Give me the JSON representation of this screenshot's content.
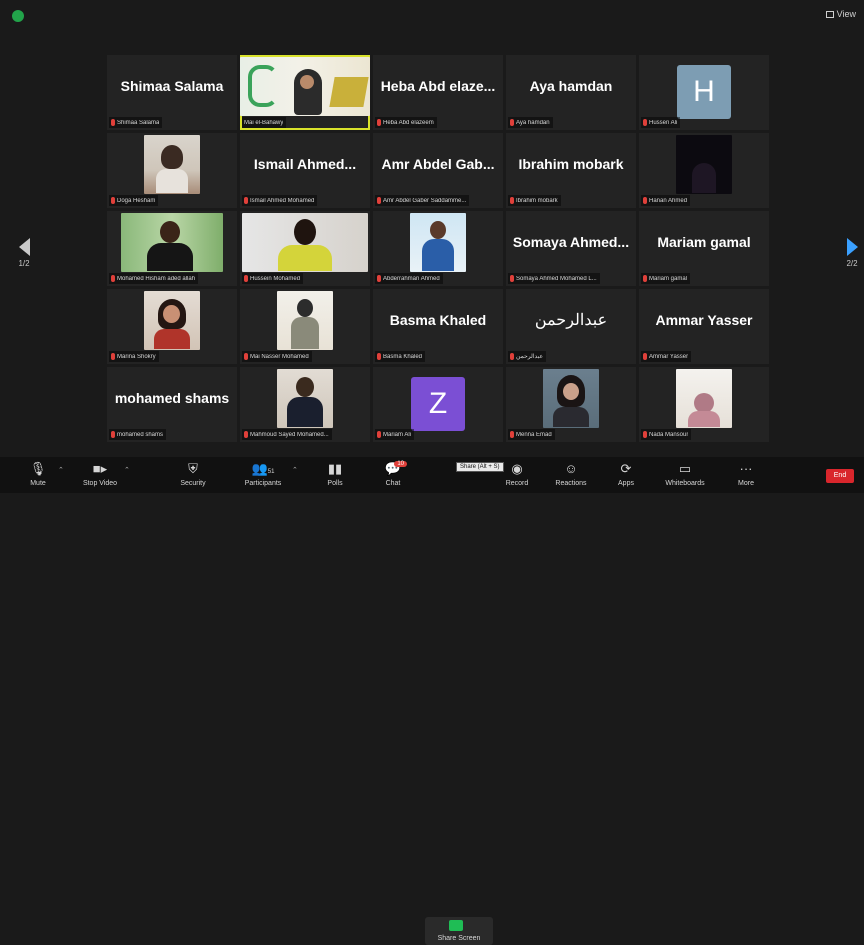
{
  "window": {
    "view_label": "View"
  },
  "tiles": [
    {
      "display_name": "Shimaa Salama",
      "label": "Shimaa Salama"
    },
    {
      "display_name": "",
      "label": "Mai el-Bahawy"
    },
    {
      "display_name": "Heba Abd elaze...",
      "label": "Heba Abd elazeem"
    },
    {
      "display_name": "Aya hamdan",
      "label": "Aya hamdan"
    },
    {
      "display_name": "",
      "label": "Hussen Ali",
      "avatar": "H",
      "avatar_color": "#7d9db3"
    },
    {
      "display_name": "",
      "label": "Doga Hesham"
    },
    {
      "display_name": "Ismail Ahmed...",
      "label": "Ismail Ahmed Mohamed"
    },
    {
      "display_name": "Amr Abdel Gab...",
      "label": "Amr Abdel Gaber Saddamme..."
    },
    {
      "display_name": "Ibrahim mobark",
      "label": "Ibrahim mobark"
    },
    {
      "display_name": "",
      "label": "Hanan Ahmed"
    },
    {
      "display_name": "",
      "label": "Mohamed Hisham aded allah"
    },
    {
      "display_name": "",
      "label": "Hussein Mohamed"
    },
    {
      "display_name": "",
      "label": "Abderrahman Ahmed"
    },
    {
      "display_name": "Somaya Ahmed...",
      "label": "Somaya Ahmed Mohamed L..."
    },
    {
      "display_name": "Mariam gamal",
      "label": "Mariam gamal"
    },
    {
      "display_name": "",
      "label": "Marina Shokry"
    },
    {
      "display_name": "",
      "label": "Mai Nasser Mohamed"
    },
    {
      "display_name": "Basma Khaled",
      "label": "Basma Khaled"
    },
    {
      "display_name": "عبدالرحمن",
      "label": "عبدالرحمن",
      "rtl": true
    },
    {
      "display_name": "Ammar Yasser",
      "label": "Ammar Yasser"
    },
    {
      "display_name": "mohamed shams",
      "label": "mohamed shams"
    },
    {
      "display_name": "",
      "label": "Mahmoud Sayed Mohamed..."
    },
    {
      "display_name": "",
      "label": "Mariam Ali",
      "avatar": "Z",
      "avatar_color": "#7b4fd4"
    },
    {
      "display_name": "",
      "label": "Menna Emad"
    },
    {
      "display_name": "",
      "label": "Nada Mansour"
    }
  ],
  "nav": {
    "left_page": "1/2",
    "right_page": "2/2"
  },
  "toolbar": {
    "mute": "Mute",
    "stop_video": "Stop Video",
    "security": "Security",
    "participants": "Participants",
    "participants_count": "51",
    "polls": "Polls",
    "chat": "Chat",
    "chat_badge": "10",
    "share_screen": "Share Screen",
    "share_tooltip": "Share (Alt + S)",
    "record": "Record",
    "reactions": "Reactions",
    "apps": "Apps",
    "whiteboards": "Whiteboards",
    "more": "More",
    "end": "End"
  },
  "colors": {
    "active_speaker": "#d9e22b",
    "muted_mic": "#e0403a",
    "end_button": "#d9262c",
    "next_arrow": "#3aa0ff"
  }
}
